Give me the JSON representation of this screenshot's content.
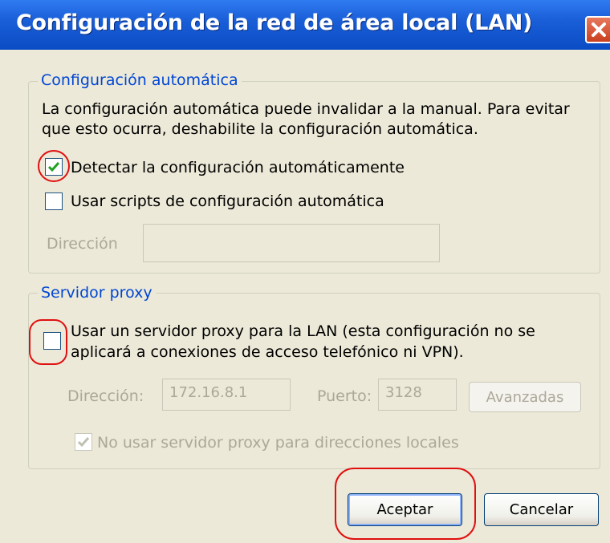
{
  "window": {
    "title": "Configuración de la red de área local (LAN)",
    "close_icon": "close-icon"
  },
  "auto": {
    "legend": "Configuración automática",
    "description_line1": "La configuración automática puede invalidar a la manual. Para evitar",
    "description_line2": "que esto ocurra, deshabilite la configuración automática.",
    "detect": {
      "label": "Detectar la configuración automáticamente",
      "checked": true
    },
    "scripts": {
      "label": "Usar scripts de configuración automática",
      "checked": false
    },
    "address_label": "Dirección",
    "address_value": ""
  },
  "proxy": {
    "legend": "Servidor proxy",
    "use_proxy_line1": "Usar un servidor proxy para la LAN (esta configuración no se",
    "use_proxy_line2": "aplicará a conexiones de acceso telefónico ni VPN).",
    "use_proxy_checked": false,
    "address_label": "Dirección:",
    "address_value": "172.16.8.1",
    "port_label": "Puerto:",
    "port_value": "3128",
    "advanced_label": "Avanzadas",
    "bypass": {
      "label": "No usar servidor proxy para direcciones locales",
      "checked": true
    }
  },
  "buttons": {
    "ok": "Aceptar",
    "cancel": "Cancelar"
  },
  "colors": {
    "title_bar": "#0a4cc4",
    "dialog_bg": "#ece9d8",
    "legend_text": "#0046d5",
    "annotation": "#e01010"
  }
}
